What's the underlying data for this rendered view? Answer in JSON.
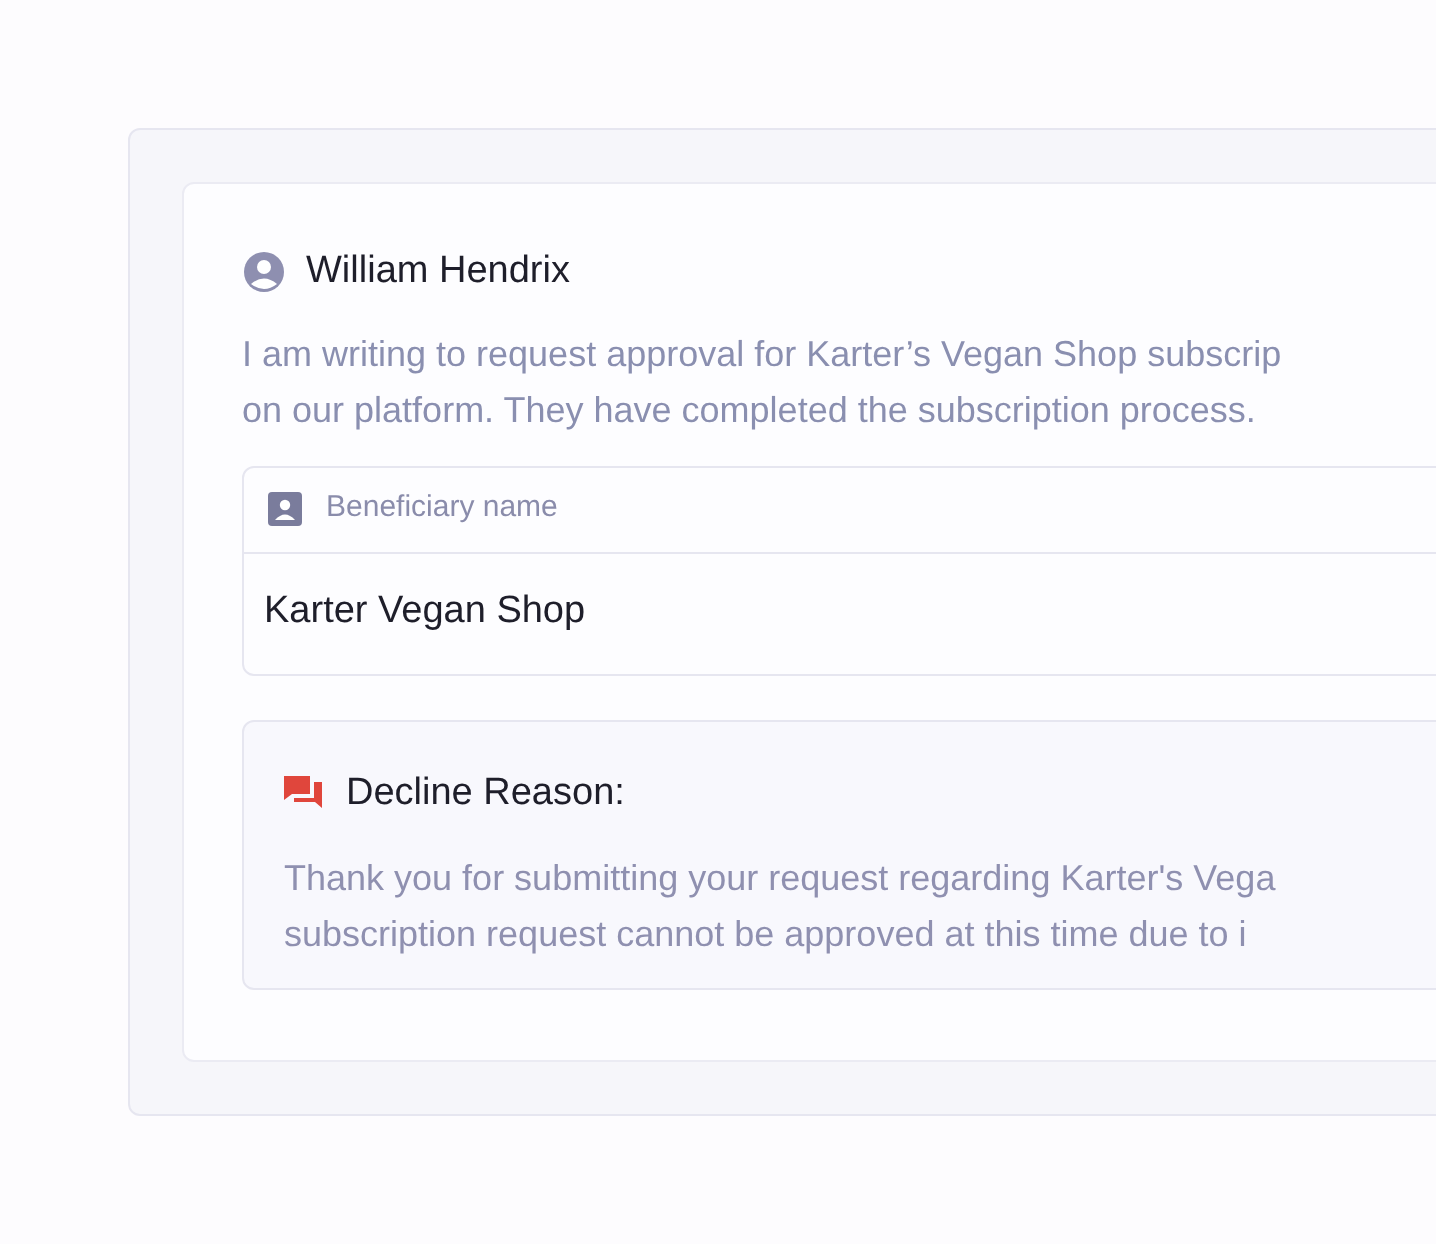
{
  "author": {
    "name": "William Hendrix"
  },
  "message_lines": [
    "I am writing to request approval for Karter’s Vegan Shop subscrip",
    "on our platform. They have completed the subscription process."
  ],
  "beneficiary": {
    "label": "Beneficiary name",
    "value": "Karter Vegan Shop"
  },
  "decline": {
    "title": "Decline Reason:",
    "lines": [
      "Thank you for submitting your request regarding Karter's Vega",
      "subscription request cannot be approved at this time due to i"
    ]
  }
}
